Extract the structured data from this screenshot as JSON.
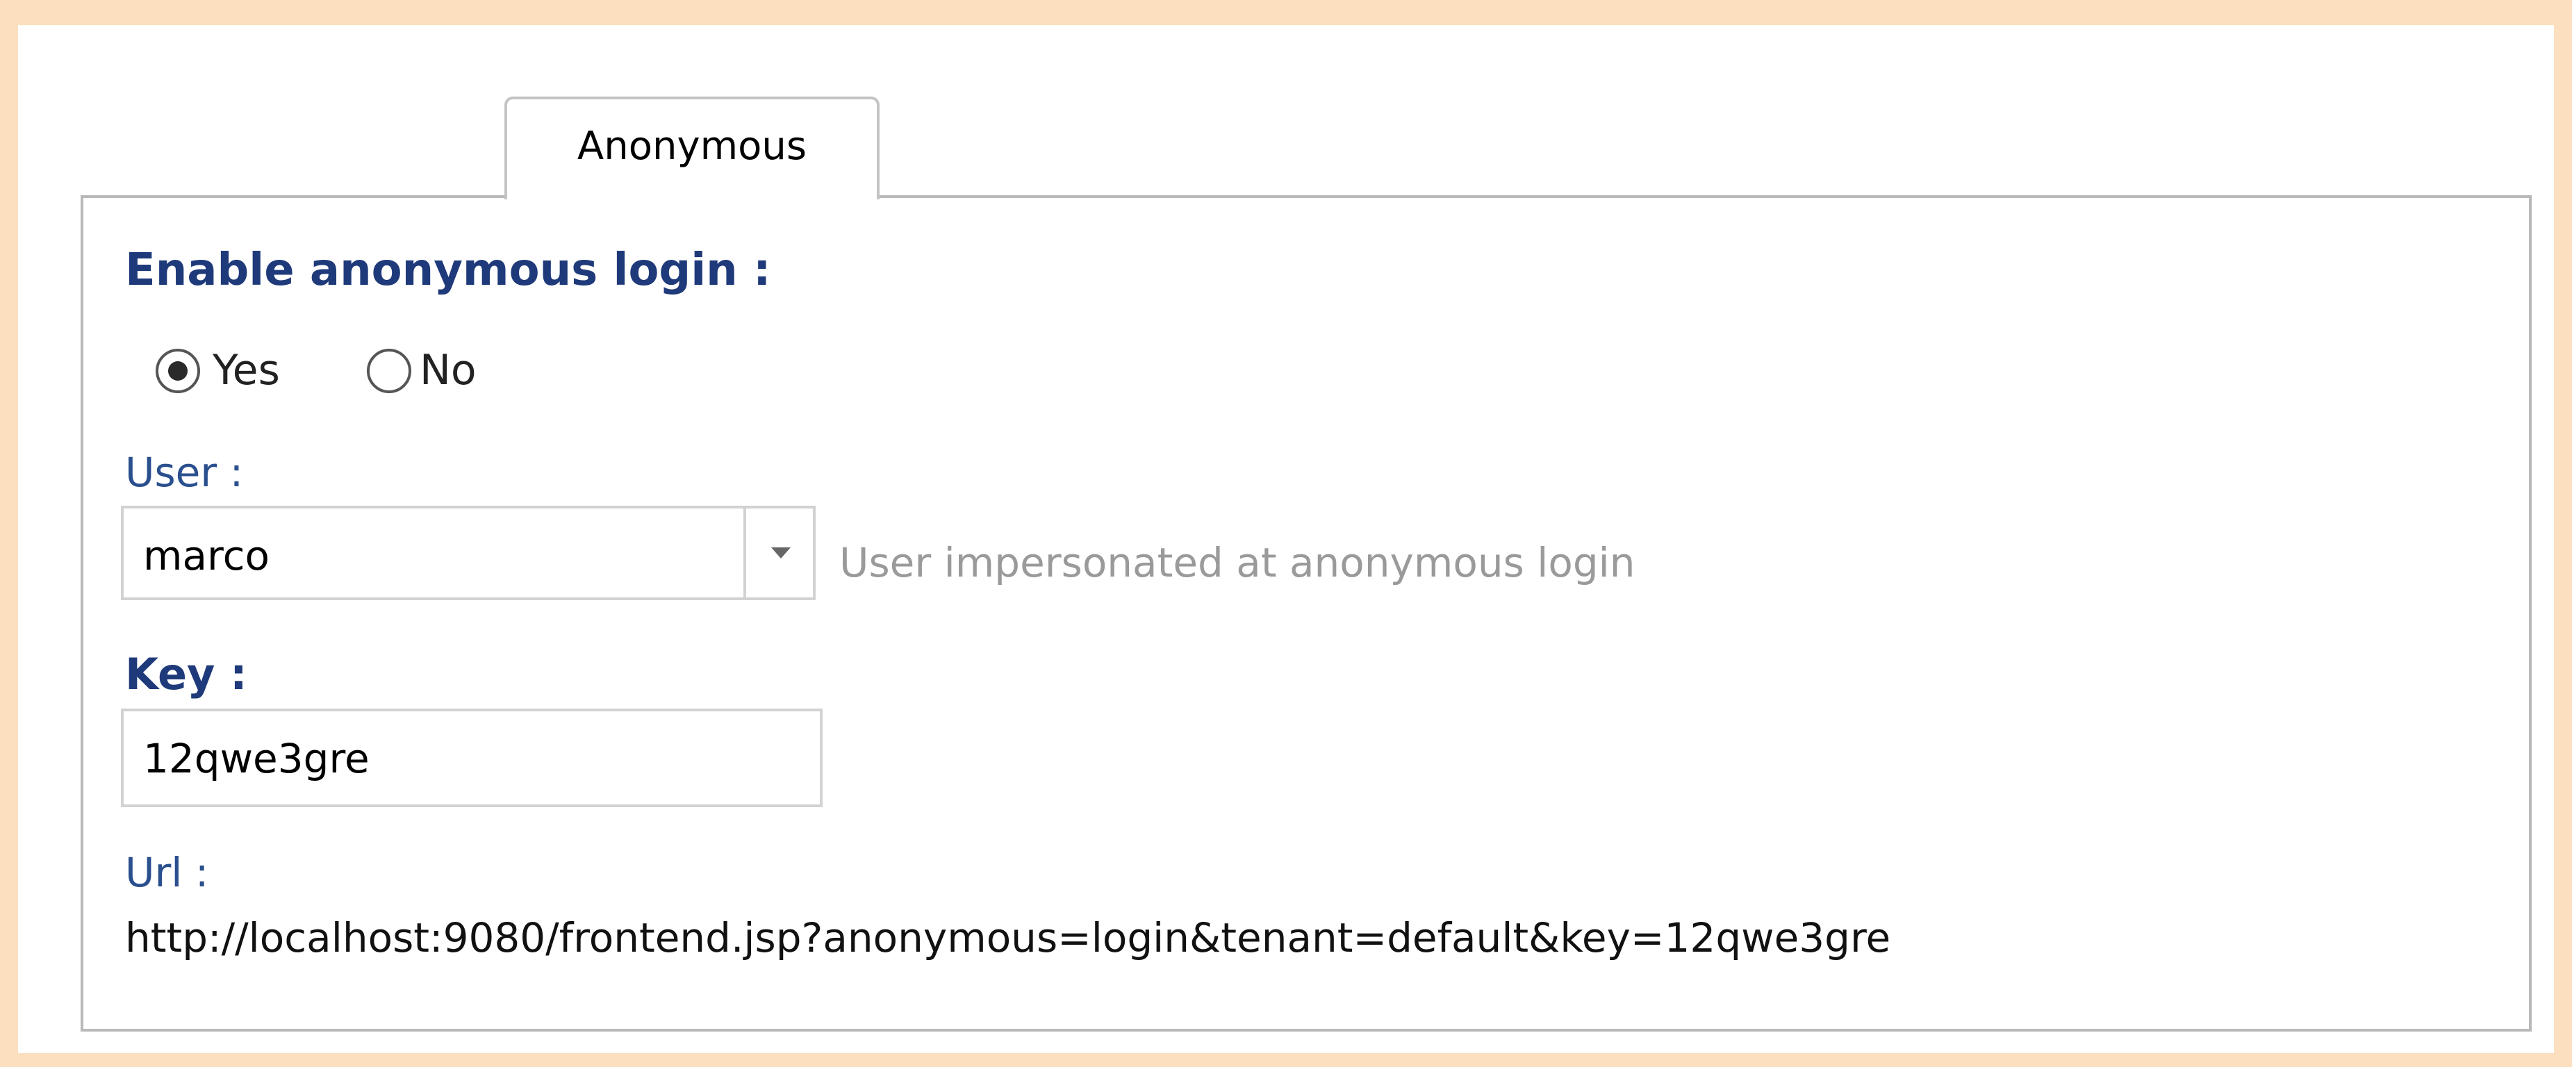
{
  "tabs": [
    {
      "label": "Anonymous",
      "active": true
    }
  ],
  "anonymous_login": {
    "title": "Enable anonymous login :",
    "options": [
      {
        "label": "Yes",
        "selected": true
      },
      {
        "label": "No",
        "selected": false
      }
    ]
  },
  "user": {
    "label": "User :",
    "value": "marco",
    "hint": "User impersonated at anonymous login"
  },
  "key": {
    "label": "Key :",
    "value": "12qwe3gre"
  },
  "url": {
    "label": "Url :",
    "value": "http://localhost:9080/frontend.jsp?anonymous=login&tenant=default&key=12qwe3gre"
  },
  "colors": {
    "background": "#fcdfbe",
    "heading": "#1f3a7a",
    "label": "#2a4f8e",
    "hint": "#9a9a9a",
    "border": "#b9b9b9"
  },
  "icons": {
    "dropdown": "chevron-down-icon"
  }
}
